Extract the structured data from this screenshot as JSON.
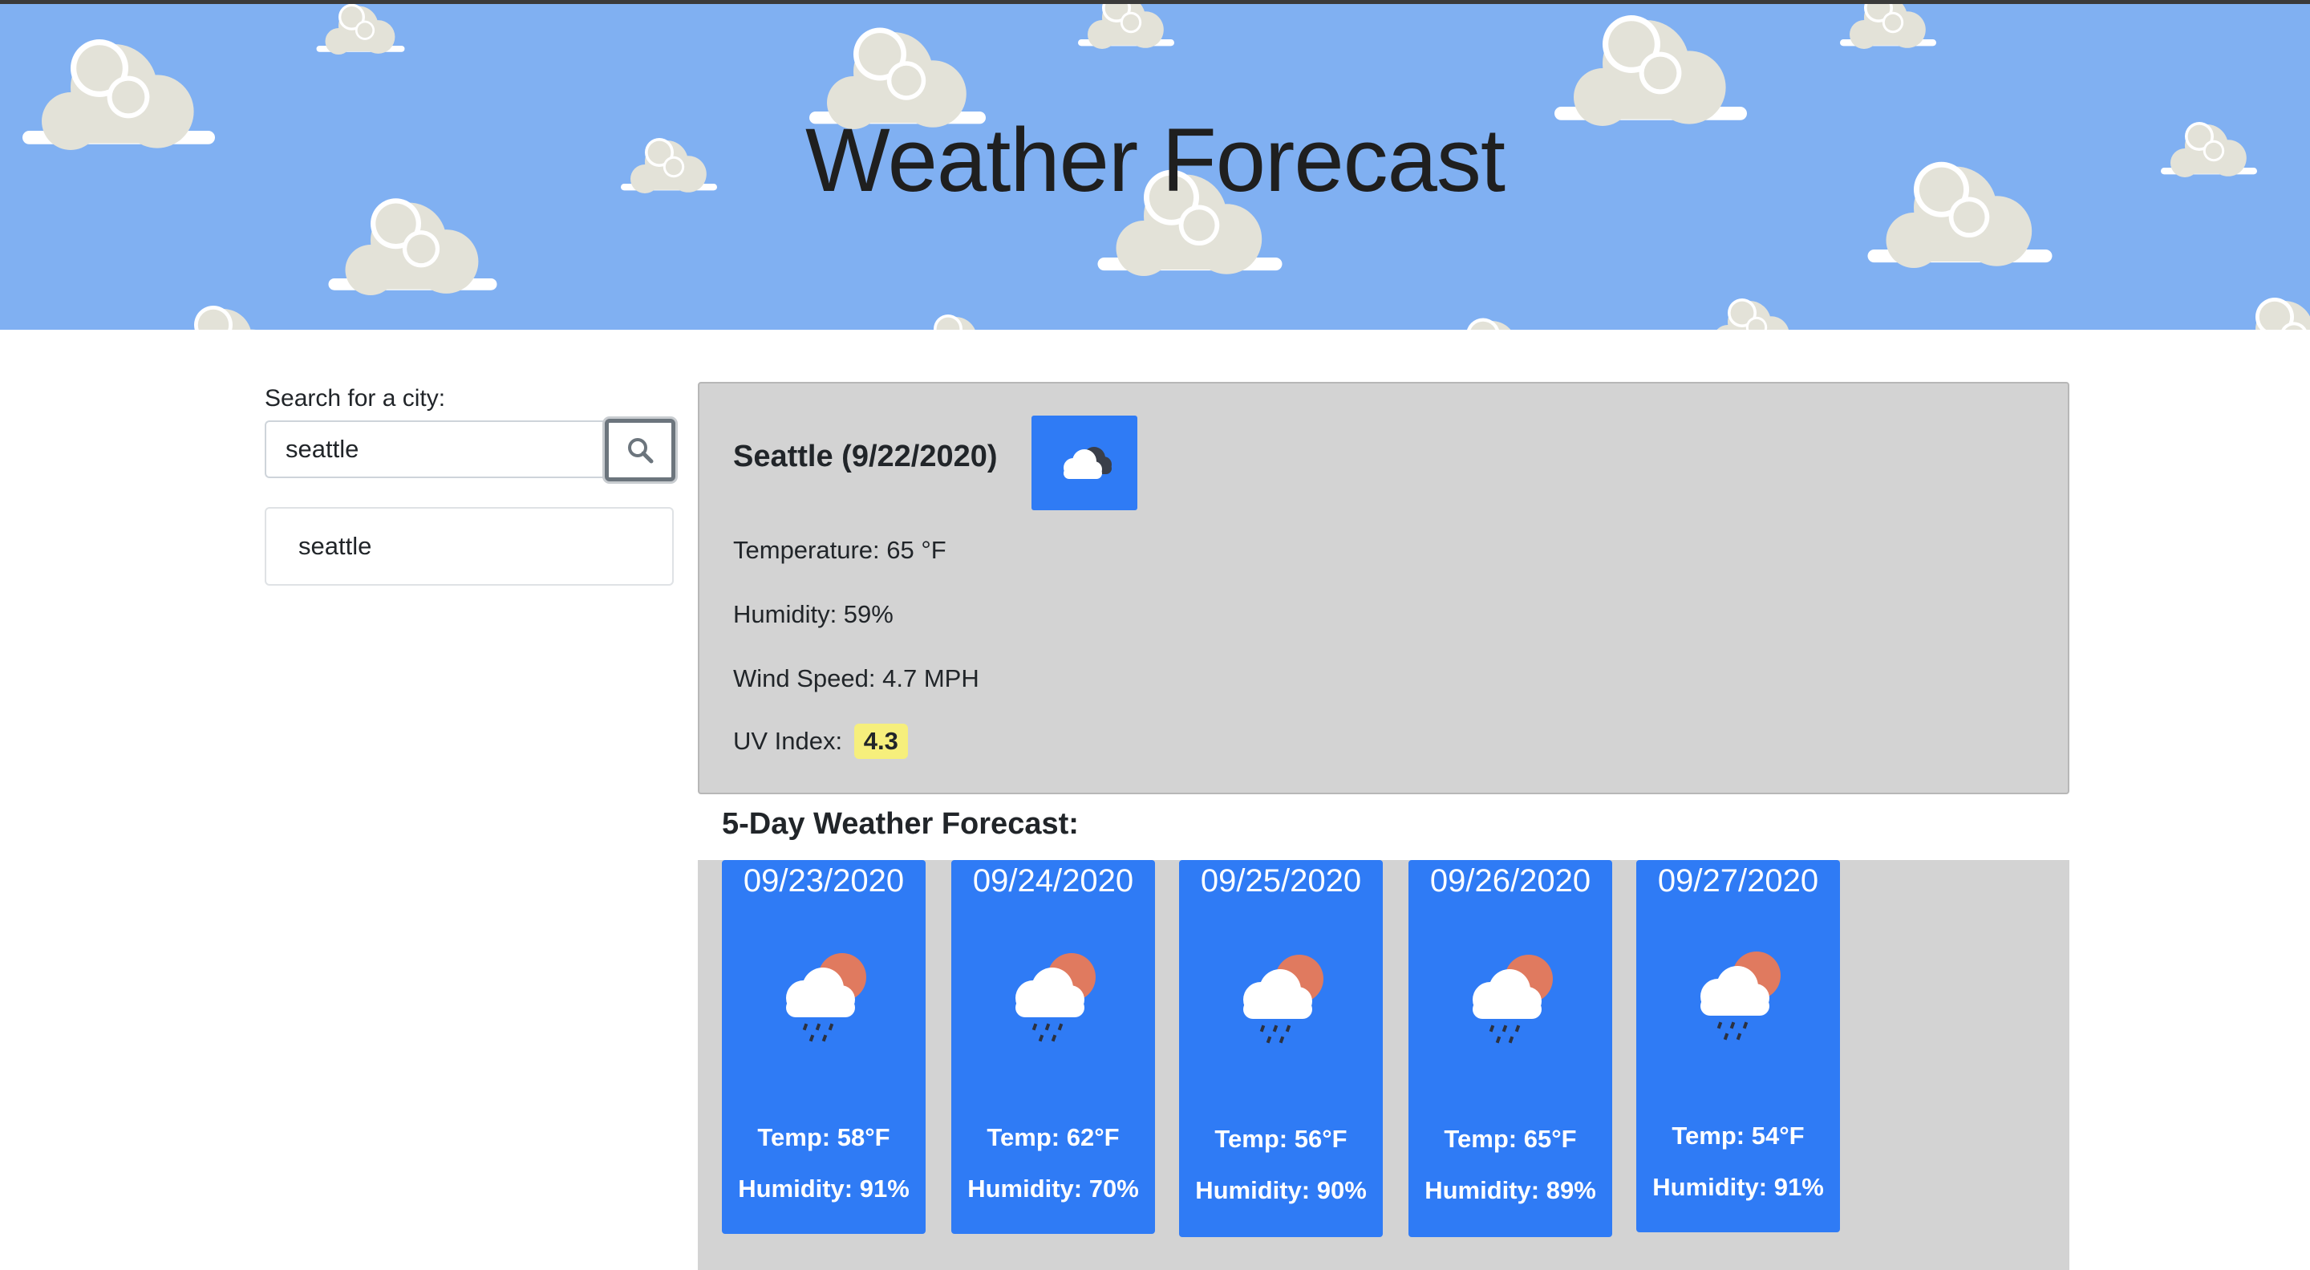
{
  "header": {
    "title": "Weather Forecast"
  },
  "search": {
    "label": "Search for a city:",
    "value": "seattle"
  },
  "history": [
    "seattle"
  ],
  "current": {
    "city_date": "Seattle (9/22/2020)",
    "temperature": "Temperature: 65 °F",
    "humidity": "Humidity: 59%",
    "wind": "Wind Speed: 4.7 MPH",
    "uv_label": "UV Index:",
    "uv_value": "4.3",
    "icon": "cloudy-icon"
  },
  "forecast": {
    "title": "5-Day Weather Forecast:",
    "days": [
      {
        "date": "09/23/2020",
        "temp": "Temp: 58°F",
        "humidity": "Humidity: 91%",
        "icon": "rain-sun-icon"
      },
      {
        "date": "09/24/2020",
        "temp": "Temp: 62°F",
        "humidity": "Humidity: 70%",
        "icon": "rain-sun-icon"
      },
      {
        "date": "09/25/2020",
        "temp": "Temp: 56°F",
        "humidity": "Humidity: 90%",
        "icon": "rain-sun-icon"
      },
      {
        "date": "09/26/2020",
        "temp": "Temp: 65°F",
        "humidity": "Humidity: 89%",
        "icon": "rain-sun-icon"
      },
      {
        "date": "09/27/2020",
        "temp": "Temp: 54°F",
        "humidity": "Humidity: 91%",
        "icon": "rain-sun-icon"
      }
    ]
  },
  "colors": {
    "banner_sky": "#80b0f2",
    "card_blue": "#2f7bf5",
    "panel_gray": "#d3d3d3",
    "uv_yellow": "#f6ef7c"
  }
}
